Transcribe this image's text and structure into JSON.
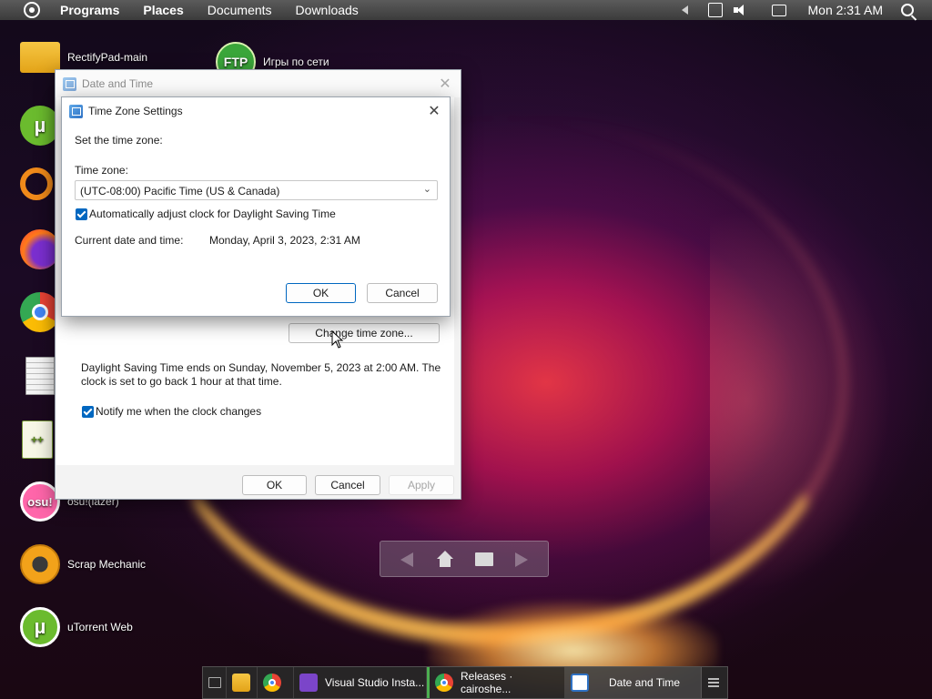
{
  "top_panel": {
    "menus": [
      "Programs",
      "Places",
      "Documents",
      "Downloads"
    ],
    "clock": "Mon 2:31 AM"
  },
  "desktop_icons": [
    {
      "label": "RectifyPad-main",
      "icon": "folder-icon"
    },
    {
      "label": "Игры по сети",
      "icon": "ftp-icon"
    },
    {
      "label": "osu!(lazer)",
      "icon": "osu-icon"
    },
    {
      "label": "Scrap Mechanic",
      "icon": "scrap-mechanic-icon"
    },
    {
      "label": "uTorrent Web",
      "icon": "utorrent-icon"
    }
  ],
  "date_time_window": {
    "title": "Date and Time",
    "change_tz_button": "Change time zone...",
    "dst_note": "Daylight Saving Time ends on Sunday, November 5, 2023 at 2:00 AM. The clock is set to go back 1 hour at that time.",
    "notify_label": "Notify me when the clock changes",
    "notify_checked": true,
    "ok": "OK",
    "cancel": "Cancel",
    "apply": "Apply"
  },
  "tz_dialog": {
    "title": "Time Zone Settings",
    "set_label": "Set the time zone:",
    "tz_label": "Time zone:",
    "tz_value": "(UTC-08:00) Pacific Time (US & Canada)",
    "dst_label": "Automatically adjust clock for Daylight Saving Time",
    "dst_checked": true,
    "current_label": "Current date and time:",
    "current_value": "Monday, April 3, 2023, 2:31 AM",
    "ok": "OK",
    "cancel": "Cancel"
  },
  "taskbar": {
    "tasks": [
      {
        "label": "Visual Studio Insta...",
        "icon": "visual-studio-icon"
      },
      {
        "label": "Releases · cairoshe...",
        "icon": "chrome-icon"
      },
      {
        "label": "Date and Time",
        "icon": "date-time-icon"
      }
    ]
  }
}
